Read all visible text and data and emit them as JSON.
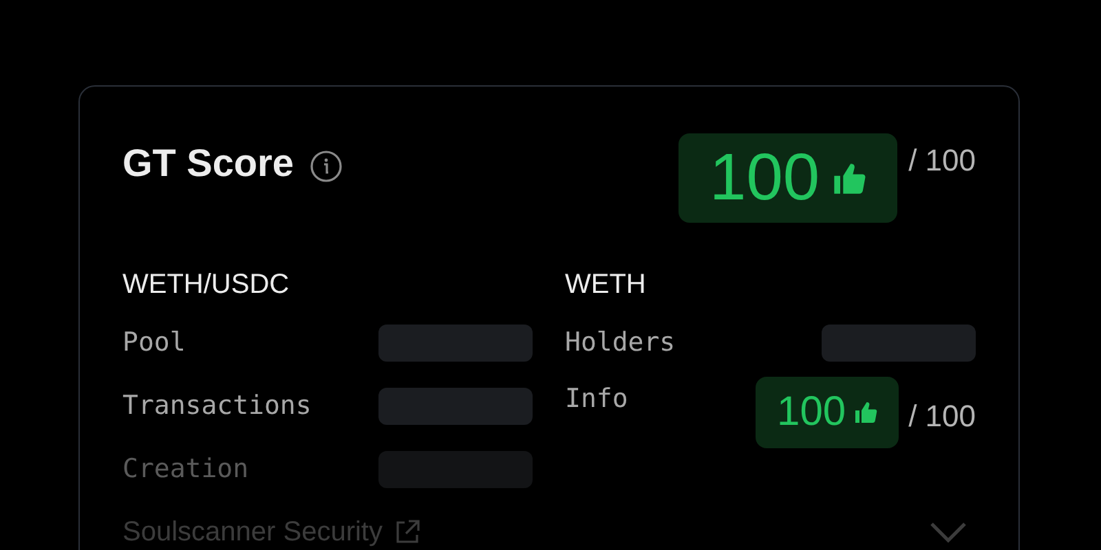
{
  "card": {
    "title": "GT Score",
    "score": {
      "value": "100",
      "max": "/ 100"
    },
    "sections": [
      {
        "heading": "WETH/USDC",
        "rows": [
          {
            "label": "Pool",
            "kind": "skeleton",
            "dimmed": false
          },
          {
            "label": "Transactions",
            "kind": "skeleton",
            "dimmed": false
          },
          {
            "label": "Creation",
            "kind": "skeleton",
            "dimmed": true
          }
        ]
      },
      {
        "heading": "WETH",
        "rows": [
          {
            "label": "Holders",
            "kind": "skeleton",
            "dimmed": false
          },
          {
            "label": "Info",
            "kind": "score",
            "value": "100",
            "max": "/ 100",
            "dimmed": false
          }
        ]
      }
    ],
    "footer_link": "Soulscanner Security"
  }
}
